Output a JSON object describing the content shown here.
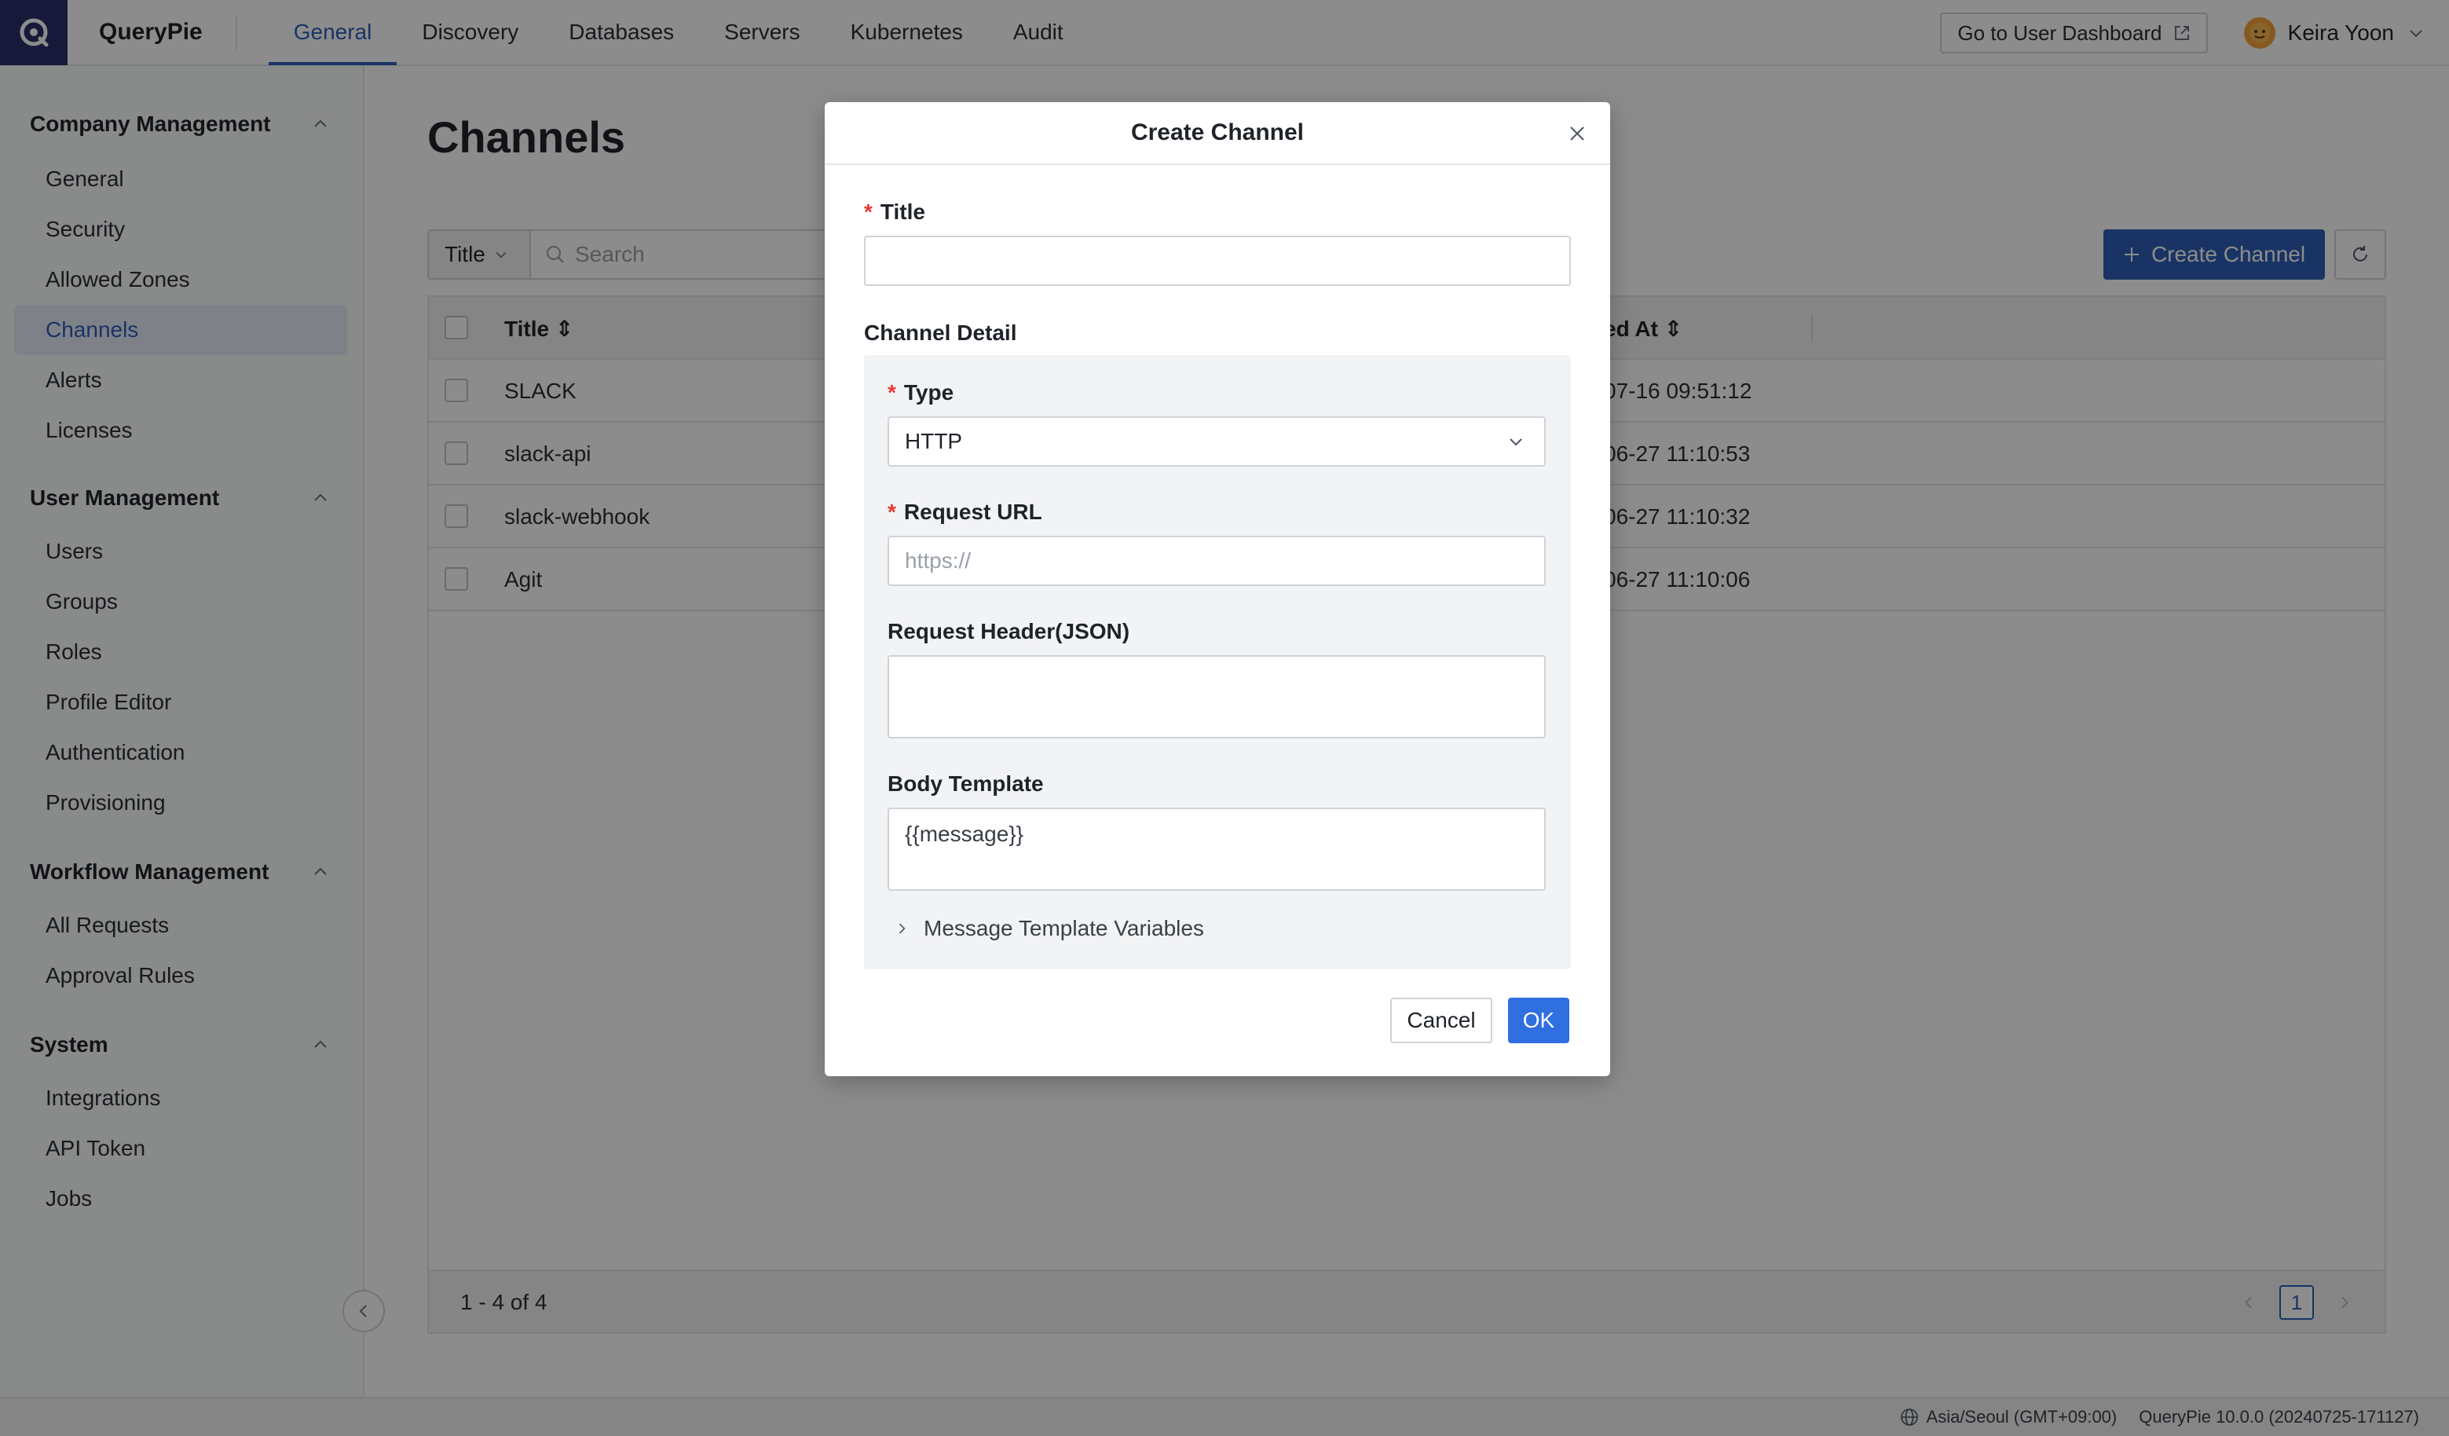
{
  "app": {
    "brand": "QueryPie"
  },
  "topnav": {
    "tabs": [
      "General",
      "Discovery",
      "Databases",
      "Servers",
      "Kubernetes",
      "Audit"
    ],
    "active": "General"
  },
  "header": {
    "dashboard_btn": "Go to User Dashboard",
    "user_name": "Keira Yoon"
  },
  "sidebar": {
    "sections": [
      {
        "title": "Company Management",
        "items": [
          "General",
          "Security",
          "Allowed Zones",
          "Channels",
          "Alerts",
          "Licenses"
        ]
      },
      {
        "title": "User Management",
        "items": [
          "Users",
          "Groups",
          "Roles",
          "Profile Editor",
          "Authentication",
          "Provisioning"
        ]
      },
      {
        "title": "Workflow Management",
        "items": [
          "All Requests",
          "Approval Rules"
        ]
      },
      {
        "title": "System",
        "items": [
          "Integrations",
          "API Token",
          "Jobs"
        ]
      }
    ],
    "active_item": "Channels"
  },
  "page": {
    "title": "Channels",
    "filter_label": "Title",
    "search_placeholder": "Search",
    "create_btn": "Create Channel"
  },
  "table": {
    "col_title": "Title",
    "col_date": "ed At",
    "rows": [
      {
        "name": "SLACK",
        "date": "07-16 09:51:12"
      },
      {
        "name": "slack-api",
        "date": "06-27 11:10:53"
      },
      {
        "name": "slack-webhook",
        "date": "06-27 11:10:32"
      },
      {
        "name": "Agit",
        "date": "06-27 11:10:06"
      }
    ],
    "range": "1 - 4 of 4",
    "page": "1"
  },
  "statusbar": {
    "timezone": "Asia/Seoul (GMT+09:00)",
    "version": "QueryPie 10.0.0 (20240725-171127)"
  },
  "modal": {
    "title": "Create Channel",
    "title_label": "Title",
    "title_value": "",
    "detail_label": "Channel Detail",
    "type_label": "Type",
    "type_value": "HTTP",
    "url_label": "Request URL",
    "url_placeholder": "https://",
    "header_label": "Request Header(JSON)",
    "header_value": "",
    "body_label": "Body Template",
    "body_value": "{{message}}",
    "vars_label": "Message Template Variables",
    "cancel": "Cancel",
    "ok": "OK"
  },
  "colors": {
    "accent": "#2f5fb6",
    "ok_button": "#2f6fe0",
    "required": "#e53935"
  }
}
